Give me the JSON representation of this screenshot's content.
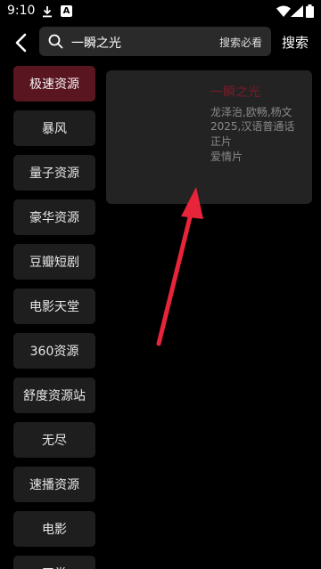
{
  "status": {
    "time": "9:10",
    "notif_letter": "A"
  },
  "header": {
    "search_value": "一瞬之光",
    "search_hint": "搜索必看",
    "search_label": "搜索"
  },
  "sidebar": {
    "items": [
      {
        "label": "极速资源",
        "active": true
      },
      {
        "label": "暴风"
      },
      {
        "label": "量子资源"
      },
      {
        "label": "豪华资源"
      },
      {
        "label": "豆瓣短剧"
      },
      {
        "label": "电影天堂"
      },
      {
        "label": "360资源"
      },
      {
        "label": "舒度资源站"
      },
      {
        "label": "无尽"
      },
      {
        "label": "速播资源"
      },
      {
        "label": "电影"
      },
      {
        "label": "天堂"
      }
    ]
  },
  "result": {
    "title": "一瞬之光",
    "cast": "龙泽治,欧畅,杨文",
    "year_lang": "2025,汉语普通话",
    "type": "正片",
    "genre": "爱情片"
  },
  "colors": {
    "active_item": "#5a1620",
    "title_color": "#7a1b2a",
    "arrow": "#e8243a"
  }
}
